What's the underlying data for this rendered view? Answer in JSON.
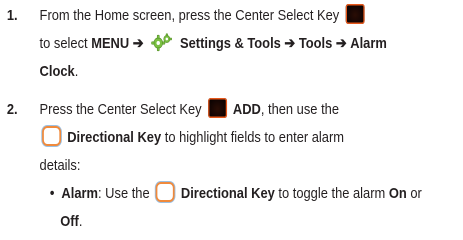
{
  "steps": [
    {
      "number": "1.",
      "line1_a": "From the Home screen, press the Center Select Key",
      "line2_a": "to select",
      "menu": "MENU",
      "arrow": "➔",
      "settings": "Settings & Tools",
      "tools": "Tools",
      "alarm_clock_1": "Alarm",
      "alarm_clock_2": "Clock",
      "period": "."
    },
    {
      "number": "2.",
      "line1_a": "Press the Center Select Key",
      "add": "ADD",
      "line1_b": ", then use the",
      "directional_key": "Directional Key",
      "line2_b": "to highlight fields to enter alarm",
      "line3": "details:"
    }
  ],
  "bullet": {
    "marker": "•",
    "label": "Alarm",
    "text_a": ": Use the",
    "directional_key": "Directional Key",
    "text_b": "to toggle the alarm",
    "on": "On",
    "or": "or",
    "off": "Off",
    "period": "."
  },
  "icons": {
    "center_key": "center-select-key-icon",
    "directional_key": "directional-key-icon",
    "settings": "gear-settings-icon"
  },
  "colors": {
    "text": "#231f20",
    "key_dark": "#140503",
    "key_accent": "#e8581b",
    "dir_key_orange": "#f08a3c",
    "dir_key_blue": "#9cc0e2",
    "gear_green": "#7bc043"
  }
}
